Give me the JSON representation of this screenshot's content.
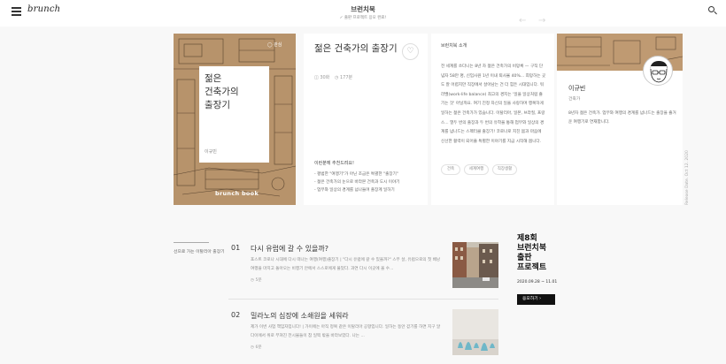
{
  "header": {
    "logo": "brunch",
    "title": "브런치북",
    "subtitle": "✓ 출판 프로젝트 응모 완료!"
  },
  "cover": {
    "badge": "◯ 관심",
    "title": "젊은\n건축가의\n출장기",
    "author": "이규빈",
    "brand": "brunch book"
  },
  "book": {
    "title": "젊은 건축가의 출장기",
    "chapters": "◫ 30화",
    "minutes": "◷ 177분",
    "like_icon": "heart-icon",
    "recommend_head": "이런분께 추천드려요!",
    "recommend_items": [
      "- 평범한 \"여행기\"가 아닌 조금은 특별한 \"출장기\"",
      "- 젊은 건축가의 눈으로 바라본 건축과 도시 이야기",
      "- 업무와 일상의 경계를 넘나들며 출장계 일하기"
    ]
  },
  "intro": {
    "label": "브런치북 소개",
    "text": "전 세계를 쏘다니는 8년 차 젊은 건축가의 비망록 — 구직 단념자 58만 명, 신입사원 1년 이내 퇴사율 40%... 희망하는 곳도 잘 어렵지만 직장에서 살아남는 건 더 힘든 시대입니다. 워라밸(work-life balance) 최고의 경지는 '일을 일상처럼 즐기는 것' 아닐까요. 여기 진정 자신의 일을 사랑하며 행복하게 일하는 젊은 건축가가 있습니다. 이탈리아, 일본, 브라질, 프랑스... 열두 번의 출장과 두 번의 유학을 통해 업무와 일상의 경계를 넘나드는 스펙터클 출장기! 코로나로 지친 몸과 마음에 신선한 활력이 되어줄 특별한 이야기를 지금 시작해 봅니다.",
    "tags": [
      "건축",
      "세계여행",
      "직장생활"
    ]
  },
  "author": {
    "name": "이규빈",
    "role": "건축가",
    "desc": "8년차 젊은 건축가. 업무와 여행의 경계를 넘나드는 출장을 즐거운 여행기로 연재합니다."
  },
  "release": "Release Date. Oct 12. 2020",
  "side_label": "선으로 가는 이탈리아 출장기",
  "articles": [
    {
      "num": "01",
      "title": "다시 유럽에 갈 수 있을까?",
      "sub": "포스트 코로나 시대에 다시 떠나는 여행(여행)출장기 | \"다시 유럽에 갈 수 있을까?\" 스무 살, 유럽으로의 첫 배낭여행을 마치고 돌아오는 비행기 안에서 스스로에게 물었다. 과연 다시 이곳에 올 수...",
      "time": "◷ 5분"
    },
    {
      "num": "02",
      "title": "밀라노의 심장에 소쇄원을 세워라",
      "sub": "제가 이번 사업 책임자입니다! | 가이에는 아직 정복 같은 이탈리아 공항입니다. 일하는 동안 걷기를 하면 지구 알다이에서 위로 부쳐진 전시물들이 참 일찍 밖을 바라보았다. 나는 ...",
      "time": "◷ 6분"
    }
  ],
  "promo": {
    "title": "제8회\n브런치북\n출판\n프로젝트",
    "dates": "2020.09.28 ~ 11.01",
    "button": "응모하기 ›"
  },
  "colors": {
    "cover_bg": "#b7936b",
    "promo_button": "#111111"
  }
}
